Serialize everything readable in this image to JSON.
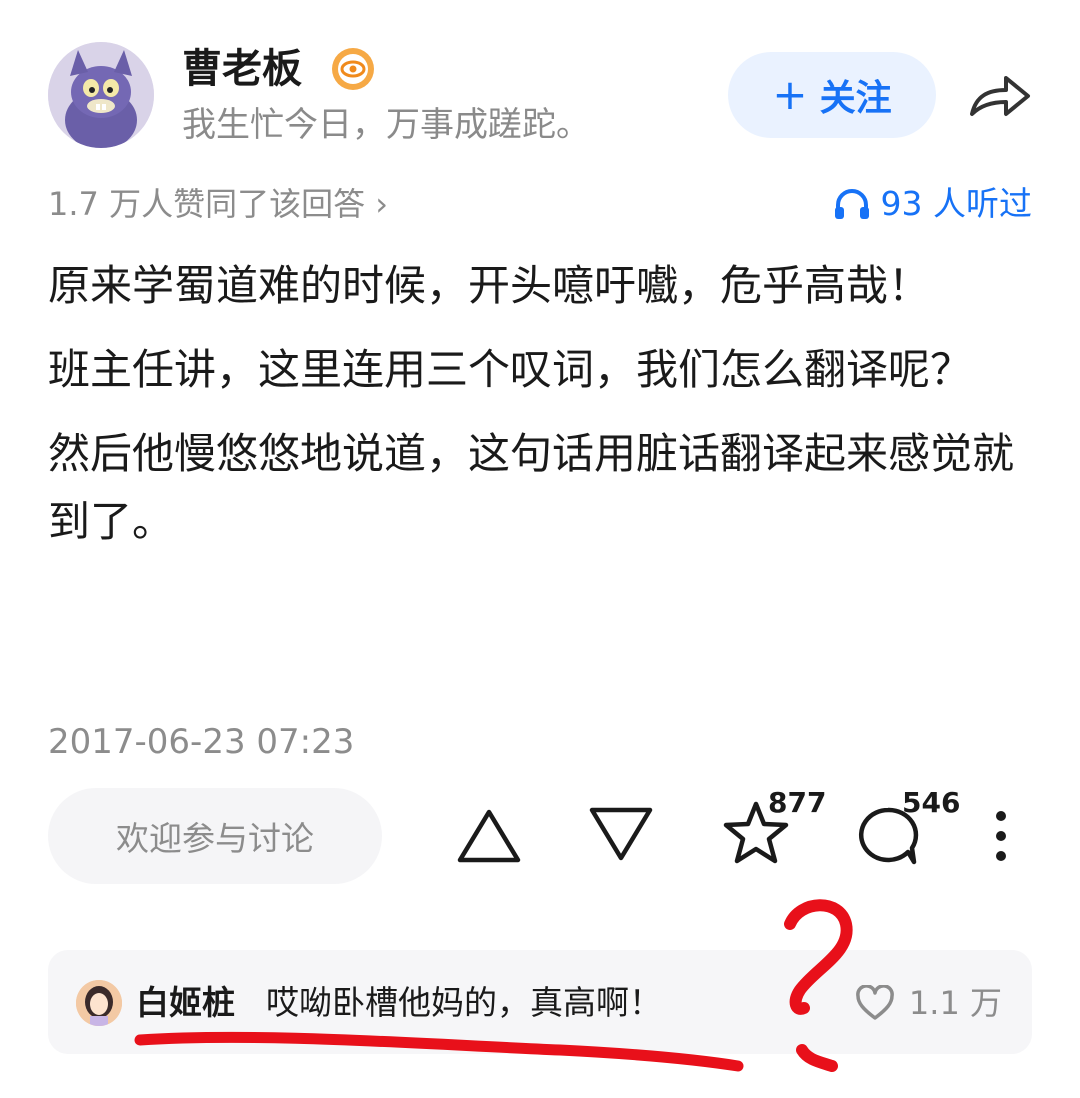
{
  "author": {
    "name": "曹老板",
    "bio": "我生忙今日，万事成蹉跎。",
    "follow_label": "关注",
    "follow_plus": "+"
  },
  "meta": {
    "agree_text": "1.7 万人赞同了该回答 ›",
    "listen_text": "93 人听过"
  },
  "content": {
    "paragraphs": [
      "原来学蜀道难的时候，开头噫吁嚱，危乎高哉！",
      "班主任讲，这里连用三个叹词，我们怎么翻译呢？",
      "然后他慢悠悠地说道，这句话用脏话翻译起来感觉就到了。"
    ],
    "timestamp": "2017-06-23 07:23"
  },
  "actions": {
    "comment_placeholder": "欢迎参与讨论",
    "favorites_count": "877",
    "comments_count": "546"
  },
  "hot_comment": {
    "user": "白姬桩",
    "text": "哎呦卧槽他妈的，真高啊！",
    "likes": "1.1 万"
  },
  "colors": {
    "accent": "#1772f6",
    "annotation_red": "#e8101a"
  },
  "icons": [
    "share-icon",
    "badge-icon",
    "headphone-icon",
    "upvote-icon",
    "downvote-icon",
    "star-icon",
    "comment-icon",
    "more-icon",
    "heart-icon"
  ]
}
